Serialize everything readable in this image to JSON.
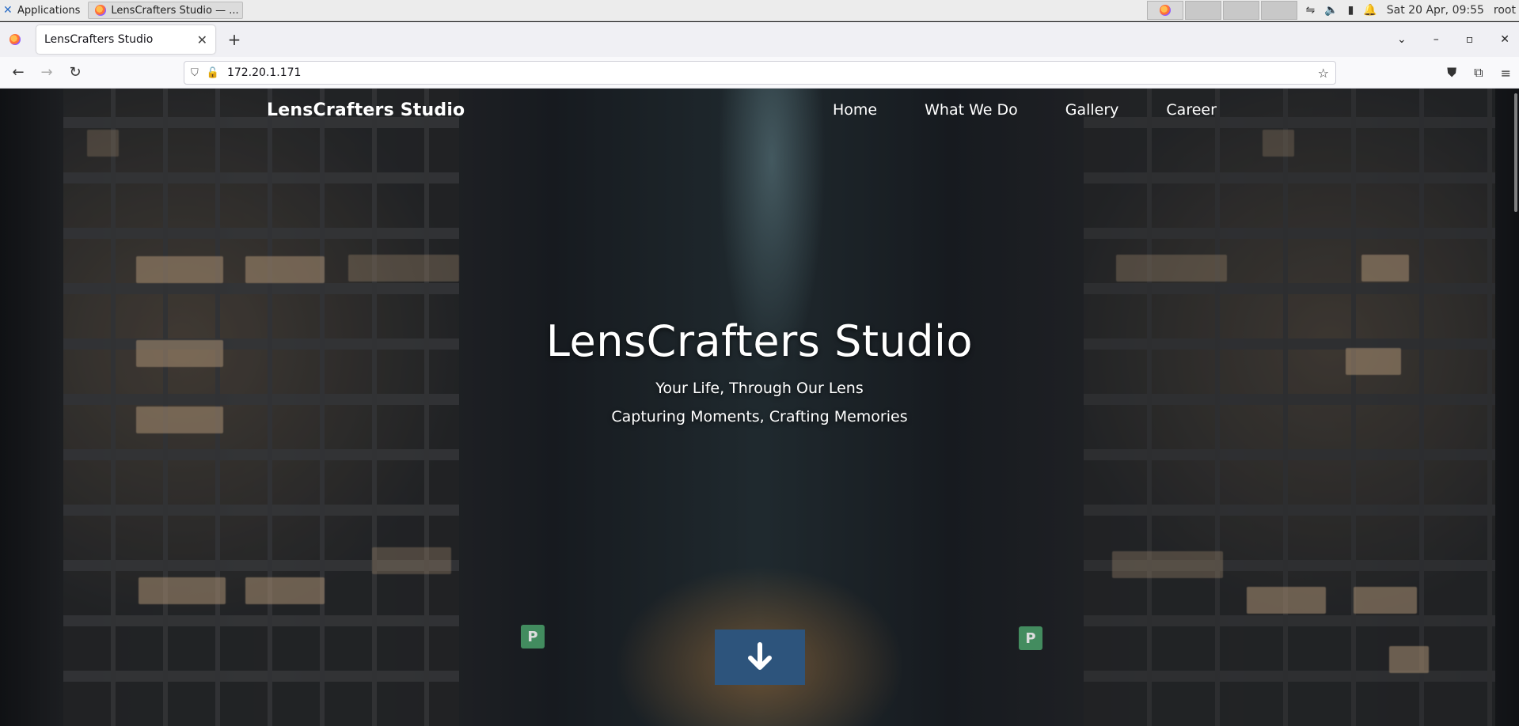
{
  "os_panel": {
    "apps_label": "Applications",
    "taskbar_item": "LensCrafters Studio — ...",
    "datetime": "Sat 20 Apr, 09:55",
    "user": "root"
  },
  "browser": {
    "tab_title": "LensCrafters Studio",
    "url": "172.20.1.171"
  },
  "site": {
    "brand": "LensCrafters Studio",
    "nav": [
      "Home",
      "What We Do",
      "Gallery",
      "Career"
    ],
    "hero": {
      "title": "LensCrafters Studio",
      "tagline1": "Your Life, Through Our Lens",
      "tagline2": "Capturing Moments, Crafting Memories"
    },
    "scroll_button_icon": "arrow-down-icon",
    "accent_color": "#2d547c"
  }
}
